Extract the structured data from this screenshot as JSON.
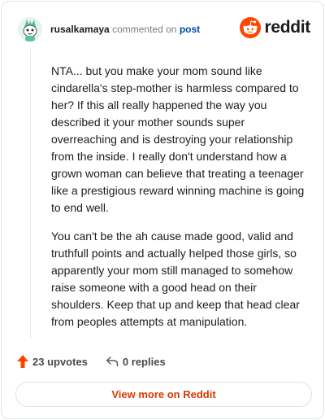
{
  "header": {
    "username": "rusalkamaya",
    "action_text": "commented on",
    "post_link": "post",
    "brand_name": "reddit"
  },
  "comment": {
    "paragraphs": [
      "NTA... but you make your mom sound like cindarella's step-mother is harmless compared to her? If this all really happened the way you described it your mother sounds super overreaching and is destroying your relationship from the inside. I really don't understand how a grown woman can believe that treating a teenager like a prestigious reward winning machine is going to end well.",
      "You can't be the ah cause made good, valid and truthfull points and actually helped those girls, so apparently your mom still managed to somehow raise someone with a good head on their shoulders. Keep that up and keep that head clear from peoples attempts at manipulation."
    ]
  },
  "footer": {
    "upvotes_label": "23 upvotes",
    "replies_label": "0 replies"
  },
  "view_more_label": "View more on Reddit",
  "colors": {
    "brand_orange": "#ff4500",
    "upvote_orange": "#ff4500",
    "link_blue": "#0045ac",
    "view_more_text": "#d93a00",
    "avatar_green": "#5bc0a4"
  },
  "icons": {
    "brand": "reddit-snoo-icon",
    "upvote": "upvote-arrow-icon",
    "reply": "reply-arrow-icon",
    "avatar": "snoo-avatar"
  }
}
